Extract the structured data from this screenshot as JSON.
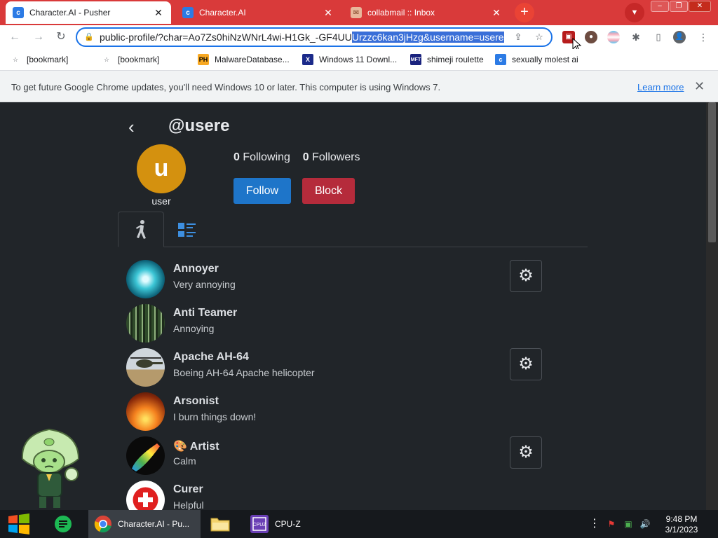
{
  "browser": {
    "tabs": [
      {
        "title": "Character.AI - Pusher",
        "active": true
      },
      {
        "title": "Character.AI",
        "active": false
      },
      {
        "title": "collabmail :: Inbox",
        "active": false
      }
    ],
    "new_tab": "+",
    "window_controls": {
      "minimize": "–",
      "maximize": "❐",
      "close": "✕"
    },
    "url_normal": "public-profile/?char=Ao7Zs0hiNzWNrL4wi-H1Gk_-GF4UU",
    "url_selected": "Urzzc6kan3jHzg&username=usere"
  },
  "bookmarks": [
    {
      "label": "[bookmark]",
      "icon": "bookmark-icon"
    },
    {
      "label": "[bookmark]",
      "icon": "bookmark-icon"
    },
    {
      "label": "MalwareDatabase...",
      "icon": "ph-icon"
    },
    {
      "label": "Windows 11 Downl...",
      "icon": "x-icon"
    },
    {
      "label": "shimeji roulette",
      "icon": "mft-icon"
    },
    {
      "label": "sexually molest ai",
      "icon": "character-ai-icon"
    }
  ],
  "infobar": {
    "message": "To get future Google Chrome updates, you'll need Windows 10 or later. This computer is using Windows 7.",
    "learn_more": "Learn more"
  },
  "profile": {
    "handle": "@usere",
    "avatar_letter": "u",
    "display_name": "user",
    "following_count": "0",
    "following_label": "Following",
    "followers_count": "0",
    "followers_label": "Followers",
    "follow_label": "Follow",
    "block_label": "Block",
    "avatar_color": "#d4910f"
  },
  "characters": [
    {
      "name": "Annoyer",
      "description": "Very annoying",
      "has_settings": true
    },
    {
      "name": "Anti Teamer",
      "description": "Annoying",
      "has_settings": false
    },
    {
      "name": "Apache AH-64",
      "description": "Boeing AH-64 Apache helicopter",
      "has_settings": true
    },
    {
      "name": "Arsonist",
      "description": "I burn things down!",
      "has_settings": false
    },
    {
      "name": "🎨 Artist",
      "description": "Calm",
      "has_settings": true
    },
    {
      "name": "Curer",
      "description": "Helpful",
      "has_settings": false
    }
  ],
  "taskbar": {
    "items": [
      {
        "label": "Character.AI - Pu...",
        "active": true
      },
      {
        "label": "CPU-Z",
        "active": false
      }
    ],
    "time": "9:48 PM",
    "date": "3/1/2023"
  },
  "colors": {
    "tab_strip": "#d93a3a",
    "page_bg": "#212529",
    "follow_button": "#1e75c9",
    "block_button": "#b52b3b",
    "link": "#1a73e8"
  }
}
